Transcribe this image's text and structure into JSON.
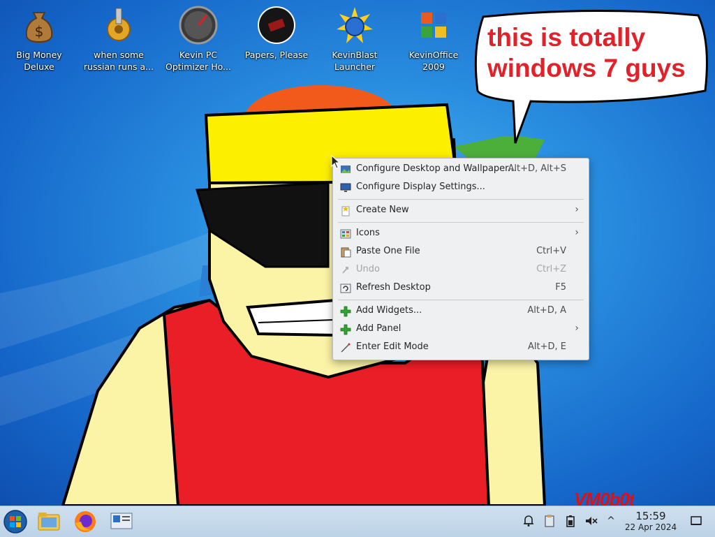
{
  "desktop_icons": [
    {
      "name": "big-money-deluxe",
      "line1": "Big Money",
      "line2": "Deluxe",
      "icon": "money-bag-icon"
    },
    {
      "name": "when-some-russian",
      "line1": "when some",
      "line2": "russian runs a...",
      "icon": "gear-icon"
    },
    {
      "name": "kevin-pc-optimizer",
      "line1": "Kevin PC",
      "line2": "Optimizer Ho...",
      "icon": "speedometer-icon"
    },
    {
      "name": "papers-please",
      "line1": "Papers, Please",
      "line2": "",
      "icon": "papers-please-icon"
    },
    {
      "name": "kevinblast-launcher",
      "line1": "KevinBlast",
      "line2": "Launcher",
      "icon": "starburst-globe-icon"
    },
    {
      "name": "kevinoffice-2009",
      "line1": "KevinOffice",
      "line2": "2009",
      "icon": "office-logo-icon"
    }
  ],
  "bubble": {
    "line1": "this is totally",
    "line2": "windows 7 guys"
  },
  "watermark": "VM0b0t",
  "context_menu": {
    "items": [
      {
        "label": "Configure Desktop and Wallpaper...",
        "shortcut": "Alt+D, Alt+S",
        "icon": "wallpaper-icon"
      },
      {
        "label": "Configure Display Settings...",
        "shortcut": "",
        "icon": "display-icon"
      },
      {
        "label": "Create New",
        "shortcut": "",
        "icon": "create-new-icon",
        "submenu": true
      },
      {
        "label": "Icons",
        "shortcut": "",
        "icon": "icons-view-icon",
        "submenu": true
      },
      {
        "label": "Paste One File",
        "shortcut": "Ctrl+V",
        "icon": "paste-icon"
      },
      {
        "label": "Undo",
        "shortcut": "Ctrl+Z",
        "icon": "undo-icon",
        "disabled": true
      },
      {
        "label": "Refresh Desktop",
        "shortcut": "F5",
        "icon": "refresh-icon"
      },
      {
        "label": "Add Widgets...",
        "shortcut": "Alt+D, A",
        "icon": "add-icon"
      },
      {
        "label": "Add Panel",
        "shortcut": "",
        "icon": "add-icon",
        "submenu": true
      },
      {
        "label": "Enter Edit Mode",
        "shortcut": "Alt+D, E",
        "icon": "edit-mode-icon"
      }
    ],
    "submenu_arrow": "›"
  },
  "taskbar": {
    "pinned": [
      "start-orb-icon",
      "file-manager-icon",
      "firefox-icon",
      "system-settings-icon"
    ],
    "tray": [
      "notifications-bell-icon",
      "clipboard-icon",
      "battery-icon",
      "volume-muted-icon",
      "expand-tray-icon"
    ],
    "expand_glyph": "^",
    "time": "15:59",
    "date": "22 Apr 2024"
  },
  "colors": {
    "wallpaper": "#2a8fe0",
    "bubble_text": "#e0232b",
    "menu_bg": "#eff0f1",
    "taskbar": "#c4d8ea"
  }
}
